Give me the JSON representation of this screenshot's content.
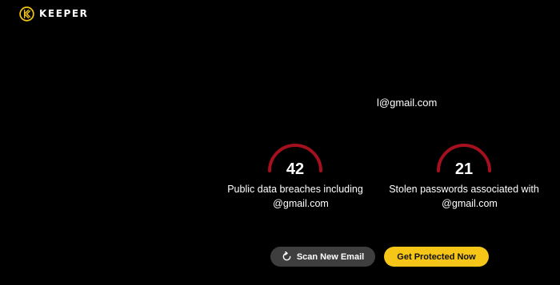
{
  "brand": {
    "name": "KEEPER",
    "accent": "#f5c518"
  },
  "email": "l@gmail.com",
  "stats": [
    {
      "value": "42",
      "label_line1": "Public data breaches including",
      "label_line2": "@gmail.com",
      "gauge_color": "#a5101e"
    },
    {
      "value": "21",
      "label_line1": "Stolen passwords associated with",
      "label_line2": "@gmail.com",
      "gauge_color": "#a5101e"
    }
  ],
  "buttons": {
    "scan_label": "Scan New Email",
    "scan_icon": "refresh-icon",
    "protect_label": "Get Protected Now",
    "protect_color": "#f5c518"
  }
}
